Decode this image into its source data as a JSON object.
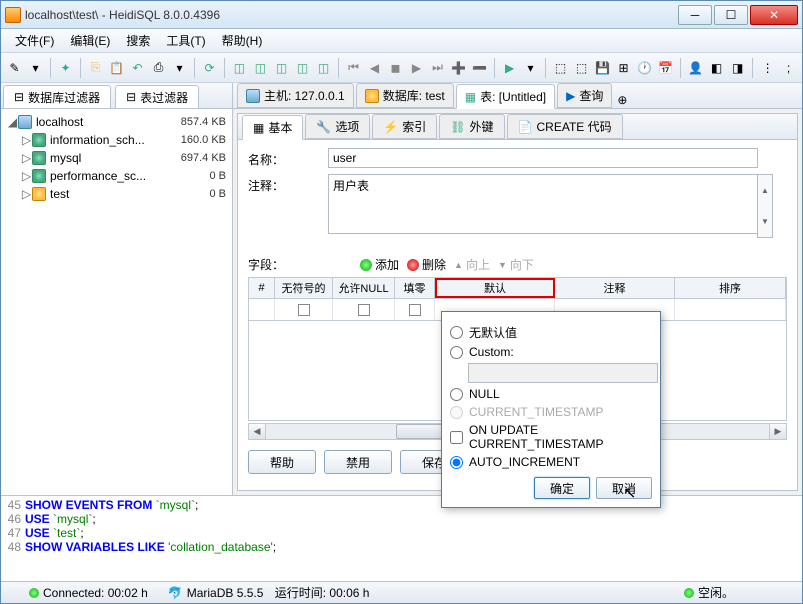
{
  "window": {
    "title": "localhost\\test\\ - HeidiSQL 8.0.0.4396"
  },
  "menu": {
    "file": "文件(F)",
    "edit": "编辑(E)",
    "search": "搜索",
    "tools": "工具(T)",
    "help": "帮助(H)"
  },
  "left_tabs": {
    "db_filter": "数据库过滤器",
    "table_filter": "表过滤器"
  },
  "tree": {
    "host": {
      "name": "localhost",
      "size": "857.4 KB"
    },
    "dbs": [
      {
        "name": "information_sch...",
        "size": "160.0 KB",
        "type": "green"
      },
      {
        "name": "mysql",
        "size": "697.4 KB",
        "type": "green"
      },
      {
        "name": "performance_sc...",
        "size": "0 B",
        "type": "green"
      },
      {
        "name": "test",
        "size": "0 B",
        "type": "yellow"
      }
    ]
  },
  "right_tabs": {
    "host": "主机: 127.0.0.1",
    "database": "数据库: test",
    "table": "表: [Untitled]",
    "query": "查询"
  },
  "sub_tabs": {
    "basic": "基本",
    "options": "选项",
    "indexes": "索引",
    "foreign": "外键",
    "create": "CREATE 代码"
  },
  "form": {
    "name_label": "名称：",
    "name_value": "user",
    "comment_label": "注释：",
    "comment_value": "用户表"
  },
  "fields": {
    "label": "字段：",
    "add": "添加",
    "delete": "删除",
    "up": "向上",
    "down": "向下",
    "cols": {
      "num": "#",
      "unsigned": "无符号的",
      "allownull": "允许NULL",
      "zerofill": "填零",
      "default": "默认",
      "comment": "注释",
      "sort": "排序"
    }
  },
  "buttons": {
    "help": "帮助",
    "disable": "禁用",
    "save": "保存"
  },
  "popup": {
    "no_default": "无默认值",
    "custom": "Custom:",
    "null": "NULL",
    "current_ts": "CURRENT_TIMESTAMP",
    "on_update": "ON UPDATE CURRENT_TIMESTAMP",
    "auto_inc": "AUTO_INCREMENT",
    "ok": "确定",
    "cancel": "取消"
  },
  "sql": [
    {
      "n": "45",
      "parts": [
        [
          "kw",
          "SHOW EVENTS FROM"
        ],
        [
          "",
          " "
        ],
        [
          "str",
          "`mysql`"
        ],
        [
          "",
          ";"
        ]
      ]
    },
    {
      "n": "46",
      "parts": [
        [
          "kw",
          "USE"
        ],
        [
          "",
          " "
        ],
        [
          "str",
          "`mysql`"
        ],
        [
          "",
          ";"
        ]
      ]
    },
    {
      "n": "47",
      "parts": [
        [
          "kw",
          "USE"
        ],
        [
          "",
          " "
        ],
        [
          "str",
          "`test`"
        ],
        [
          "",
          ";"
        ]
      ]
    },
    {
      "n": "48",
      "parts": [
        [
          "kw",
          "SHOW VARIABLES LIKE"
        ],
        [
          "",
          " "
        ],
        [
          "str",
          "'collation_database'"
        ],
        [
          "",
          ";"
        ]
      ]
    }
  ],
  "status": {
    "connected": "Connected: 00:02 h",
    "server": "MariaDB 5.5.5",
    "runtime": "运行时间: 00:06 h",
    "idle": "空闲。"
  }
}
